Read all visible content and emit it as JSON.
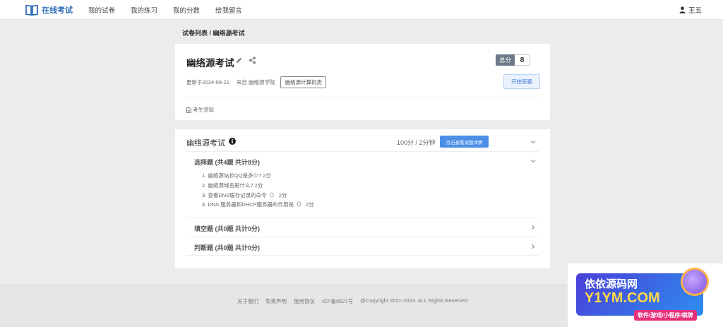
{
  "nav": {
    "brand": "在线考试",
    "items": [
      "我的试卷",
      "我的练习",
      "我的分数",
      "给我留言"
    ],
    "user": "王五"
  },
  "breadcrumb": "试卷列表 / 幽络源考试",
  "exam": {
    "title": "幽络源考试",
    "score_label": "总分",
    "score_value": "8",
    "updated": "更新于2024-09-21",
    "from": "来自 幽络源学院",
    "tag": "幽络源计算机类",
    "start_label": "开始答题",
    "notice": "考生须知"
  },
  "paper": {
    "title": "幽络源考试",
    "meta": "100分 / 2分钟",
    "detail_label": "点击查看试题详情",
    "sections": [
      {
        "title": "选择题 (共4题 共计8分)",
        "questions": [
          "1. 幽络源站长QQ是多少?   2分",
          "2. 幽络源域名是什么? 2分",
          "3. 查看DNS缓存记录的命令（）  2分",
          "4. DNS 服务器和DHCP服务器的作用是（）  2分"
        ]
      },
      {
        "title": "填空题 (共0题 共计0分)"
      },
      {
        "title": "判断题 (共0题 共计0分)"
      }
    ]
  },
  "footer": {
    "links": [
      "关于我们",
      "免责声明",
      "使用协议",
      "ICP备9527号"
    ],
    "copyright": "@Copyright 2021-2023. ALL Rights Reserved"
  },
  "watermark": {
    "line1": "依依源码网",
    "line2": "Y1YM.COM",
    "line3": "软件/游戏/小程序/棋牌"
  },
  "colors": {
    "brand": "#2d6db5",
    "primary_button": "#4c8ee6",
    "score_label_bg": "#6c7a89"
  }
}
